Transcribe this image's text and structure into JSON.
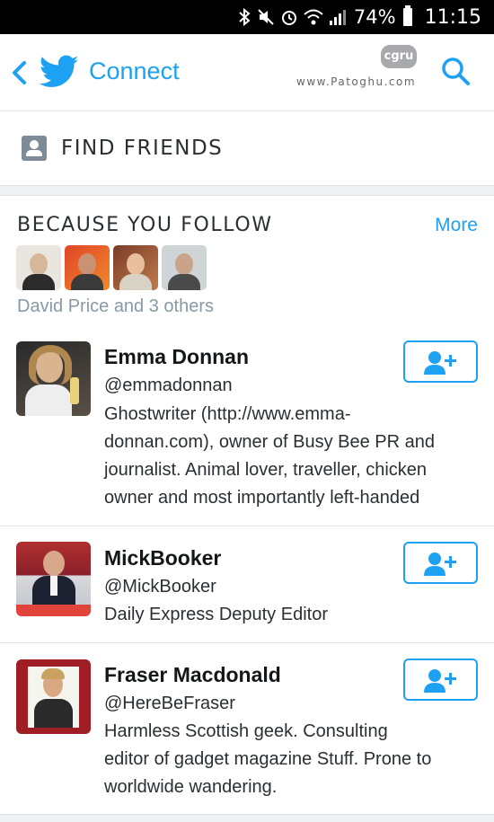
{
  "status_bar": {
    "battery_pct": "74%",
    "time": "11:15"
  },
  "appbar": {
    "title": "Connect",
    "watermark_logo": "cgru",
    "watermark_url": "www.Patoghu.com"
  },
  "find_friends": {
    "label": "FIND FRIENDS"
  },
  "because_you_follow": {
    "heading": "BECAUSE YOU FOLLOW",
    "more_label": "More",
    "subtitle": "David Price and 3 others"
  },
  "suggestions": [
    {
      "name": "Emma Donnan",
      "handle": "@emmadonnan",
      "bio_lines": [
        "Ghostwriter (http://www.emma-",
        "donnan.com), owner of Busy Bee PR and",
        "journalist. Animal lover, traveller, chicken",
        "owner and most importantly left-handed"
      ]
    },
    {
      "name": "MickBooker",
      "handle": "@MickBooker",
      "bio_lines": [
        "Daily Express Deputy Editor"
      ]
    },
    {
      "name": "Fraser Macdonald",
      "handle": "@HereBeFraser",
      "bio_lines": [
        "Harmless Scottish geek. Consulting",
        "editor of gadget magazine Stuff. Prone to",
        "worldwide wandering."
      ]
    }
  ],
  "colors": {
    "accent": "#1da1f2",
    "muted": "#8899a6",
    "icon_gray": "#7d8b99"
  },
  "icons": [
    "back-arrow",
    "twitter-bird",
    "search",
    "person-card",
    "add-person"
  ]
}
